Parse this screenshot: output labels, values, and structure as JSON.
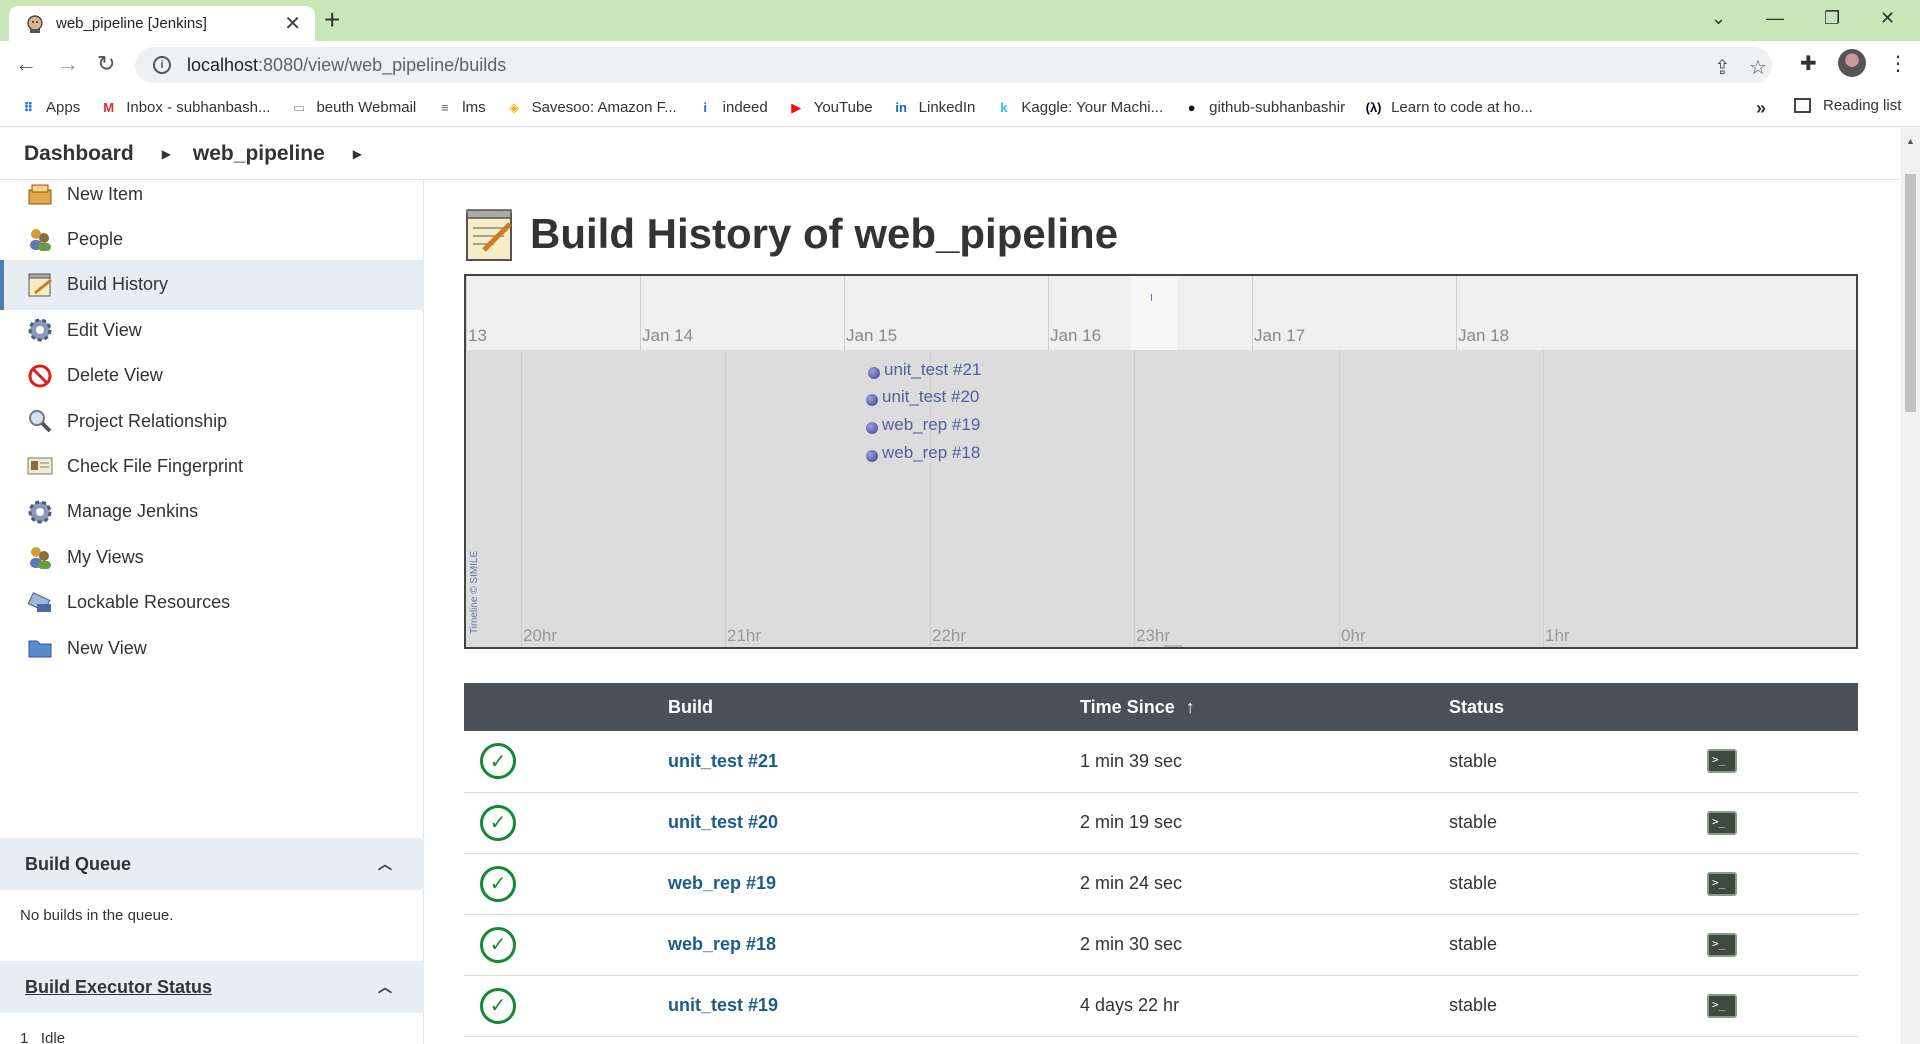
{
  "browser": {
    "tab_title": "web_pipeline [Jenkins]",
    "url_host": "localhost",
    "url_path": ":8080/view/web_pipeline/builds",
    "bookmarks": [
      {
        "label": "Apps",
        "icon": "apps-grid-icon",
        "color": "#1a73e8"
      },
      {
        "label": "Inbox - subhanbash...",
        "icon": "gmail-icon",
        "color": "#d93025"
      },
      {
        "label": "beuth Webmail",
        "icon": "webmail-icon",
        "color": "#999999"
      },
      {
        "label": "lms",
        "icon": "bht-icon",
        "color": "#666666"
      },
      {
        "label": "Savesoo: Amazon F...",
        "icon": "savesoo-icon",
        "color": "#f4b400"
      },
      {
        "label": "indeed",
        "icon": "indeed-icon",
        "color": "#2164f3"
      },
      {
        "label": "YouTube",
        "icon": "youtube-icon",
        "color": "#ff0000"
      },
      {
        "label": "LinkedIn",
        "icon": "linkedin-icon",
        "color": "#0a66c2"
      },
      {
        "label": "Kaggle: Your Machi...",
        "icon": "kaggle-icon",
        "color": "#20beff"
      },
      {
        "label": "github-subhanbashir",
        "icon": "github-icon",
        "color": "#111111"
      },
      {
        "label": "Learn to code at ho...",
        "icon": "freecodecamp-icon",
        "color": "#0a0a23"
      }
    ],
    "bookmarks_more": "»",
    "reading_list": "Reading list"
  },
  "breadcrumb": {
    "dashboard": "Dashboard",
    "view": "web_pipeline"
  },
  "sidebar": {
    "items": [
      {
        "label": "New Item",
        "icon": "new-item-icon"
      },
      {
        "label": "People",
        "icon": "people-icon"
      },
      {
        "label": "Build History",
        "icon": "build-history-icon",
        "active": true
      },
      {
        "label": "Edit View",
        "icon": "gear-icon"
      },
      {
        "label": "Delete View",
        "icon": "no-entry-icon"
      },
      {
        "label": "Project Relationship",
        "icon": "magnifier-icon"
      },
      {
        "label": "Check File Fingerprint",
        "icon": "fingerprint-icon"
      },
      {
        "label": "Manage Jenkins",
        "icon": "gear-icon"
      },
      {
        "label": "My Views",
        "icon": "people-icon"
      },
      {
        "label": "Lockable Resources",
        "icon": "lockable-resources-icon"
      },
      {
        "label": "New View",
        "icon": "folder-icon"
      }
    ],
    "build_queue": {
      "title": "Build Queue",
      "body": "No builds in the queue."
    },
    "executor_status": {
      "title": "Build Executor Status",
      "executors": [
        {
          "number": "1",
          "state": "Idle"
        }
      ]
    }
  },
  "main": {
    "title": "Build History of web_pipeline",
    "timeline": {
      "date_labels": [
        "13",
        "Jan 14",
        "Jan 15",
        "Jan 16",
        "Jan 17",
        "Jan 18"
      ],
      "hour_labels": [
        "20hr",
        "21hr",
        "22hr",
        "23hr",
        "0hr",
        "1hr"
      ],
      "events": [
        "unit_test #21",
        "unit_test #20",
        "web_rep #19",
        "web_rep #18"
      ],
      "credit": "Timeline © SIMILE"
    },
    "table": {
      "headers": {
        "build": "Build",
        "time_since": "Time Since",
        "sort_indicator": "↑",
        "status": "Status"
      },
      "rows": [
        {
          "build": "unit_test #21",
          "time_since": "1 min 39 sec",
          "status": "stable"
        },
        {
          "build": "unit_test #20",
          "time_since": "2 min 19 sec",
          "status": "stable"
        },
        {
          "build": "web_rep #19",
          "time_since": "2 min 24 sec",
          "status": "stable"
        },
        {
          "build": "web_rep #18",
          "time_since": "2 min 30 sec",
          "status": "stable"
        },
        {
          "build": "unit_test #19",
          "time_since": "4 days 22 hr",
          "status": "stable"
        }
      ]
    }
  },
  "colors": {
    "tab_strip": "#c8e6b8",
    "success_green": "#138a36",
    "link_blue": "#1d5c8a",
    "table_header": "#4b4f58",
    "active_sidebar": "#e8edf1"
  }
}
